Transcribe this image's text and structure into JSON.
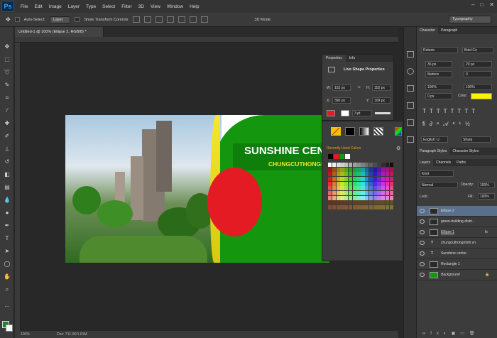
{
  "app": {
    "logo": "Ps",
    "menu": [
      "File",
      "Edit",
      "Image",
      "Layer",
      "Type",
      "Select",
      "Filter",
      "3D",
      "View",
      "Window",
      "Help"
    ]
  },
  "options": {
    "auto_select": "Auto-Select:",
    "auto_select_mode": "Layer",
    "transform": "Show Transform Controls",
    "three_d": "3D Mode:",
    "workspace": "Typography"
  },
  "document": {
    "tab": "Untitled-1 @ 100% (Ellipse 2, RGB/8) *",
    "status_zoom": "100%",
    "status_doc": "Doc: 711.3K/1.61M"
  },
  "canvas": {
    "headline": "SUNSHINE CEN",
    "subline": "CHUNGCUTHONGM",
    "ellipse_color": "#e51b24",
    "band_color": "#14960f"
  },
  "properties": {
    "tabs": [
      "Properties",
      "Info"
    ],
    "title": "Live Shape Properties",
    "w_label": "W:",
    "w": "152 px",
    "h_label": "H:",
    "h": "152 px",
    "x_label": "X:",
    "x": "390 px",
    "y_label": "Y:",
    "y": "109 px",
    "stroke_width": "3 pt",
    "recent_label": "Recently Used Colors"
  },
  "character": {
    "tabs": [
      "Character",
      "Paragraph"
    ],
    "font": "Roboto",
    "style": "Bold Co",
    "size": "36 px",
    "leading": "20 px",
    "kerning": "Metrics",
    "tracking": "0",
    "vscale": "100%",
    "hscale": "100%",
    "baseline": "0 px",
    "color_label": "Color:",
    "color": "#fff200",
    "language": "English: U",
    "aa": "Sharp"
  },
  "paragraph_styles": {
    "tabs": [
      "Paragraph Styles",
      "Character Styles"
    ]
  },
  "layers": {
    "tabs": [
      "Layers",
      "Channels",
      "Paths"
    ],
    "kind": "Kind",
    "blend": "Normal",
    "opacity_label": "Opacity:",
    "opacity": "100%",
    "lock_label": "Lock:",
    "fill_label": "Fill:",
    "fill": "100%",
    "items": [
      "Ellipse 2",
      "green-building-distri...",
      "Ellipse 1",
      "chungcuthongminh.vn",
      "Sunshine center",
      "Rectangle 1",
      "Background"
    ]
  }
}
